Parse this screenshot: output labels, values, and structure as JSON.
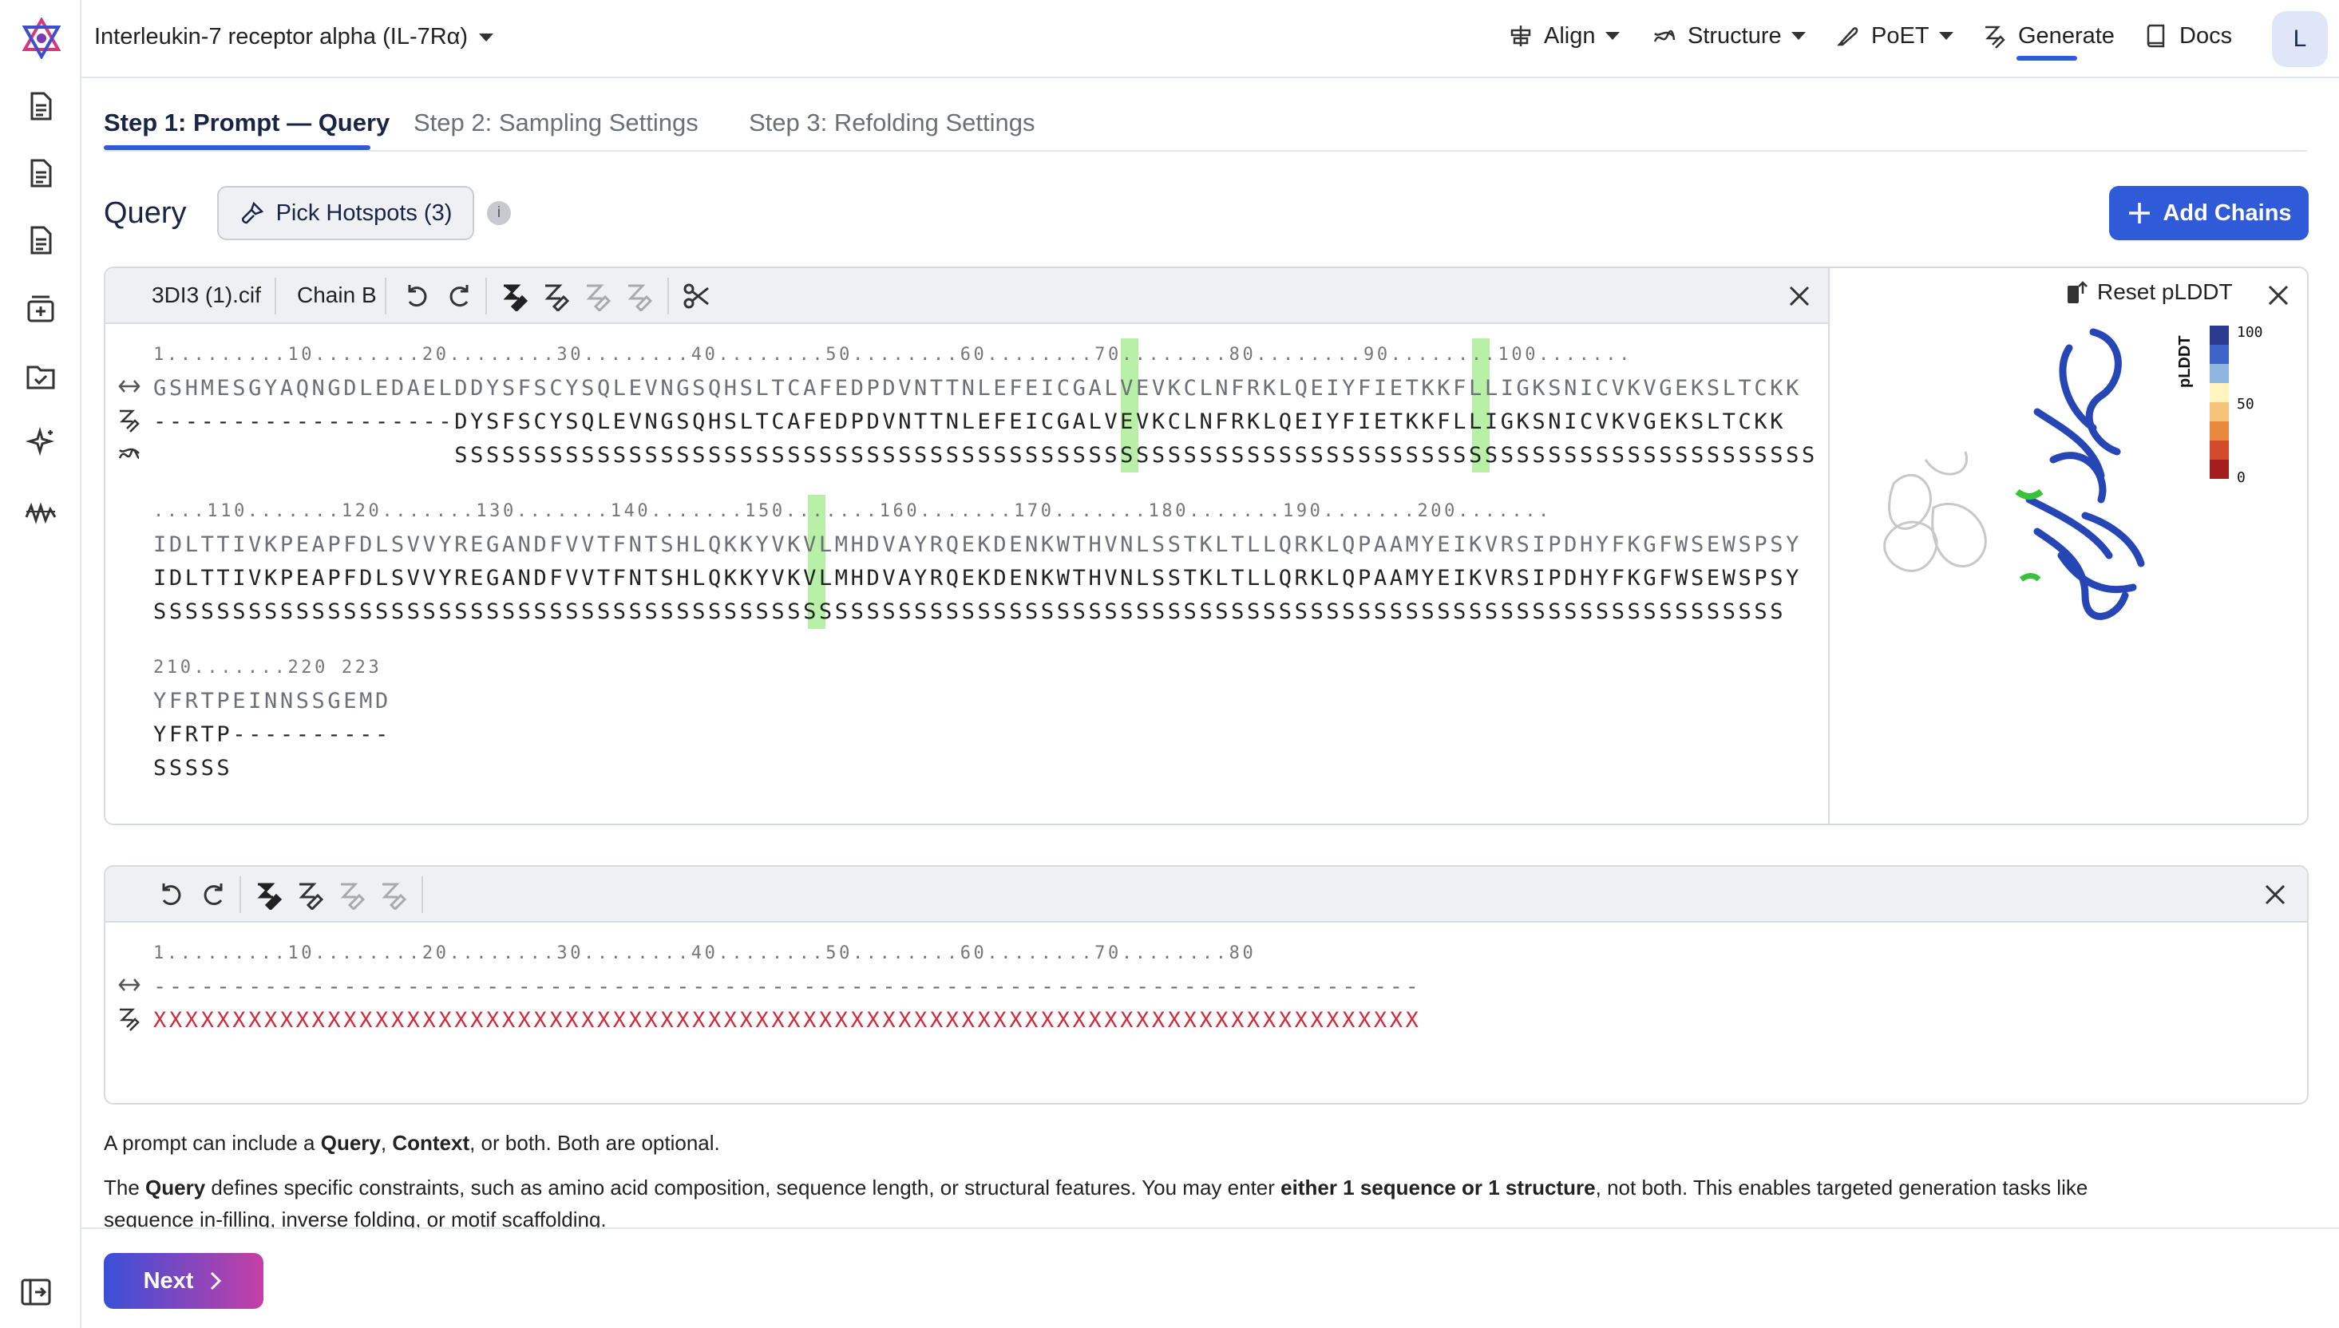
{
  "header": {
    "title": "Interleukin-7 receptor alpha (IL-7Rα)",
    "nav": [
      "Align",
      "Structure",
      "PoET",
      "Generate",
      "Docs"
    ],
    "avatar": "L"
  },
  "steps": [
    "Step 1: Prompt — Query",
    "Step 2: Sampling Settings",
    "Step 3: Refolding Settings"
  ],
  "query": {
    "label": "Query",
    "pick_hotspots": "Pick Hotspots (3)",
    "info": "i",
    "add_chains": "Add Chains"
  },
  "panel1": {
    "file": "3DI3 (1).cif",
    "chain": "Chain B",
    "block1": {
      "ruler": "1.........10........20........30........40........50........60........70........80........90........100.......",
      "seq": "GSHMESGYAQNGDLEDAELDDYSFSCYSQLEVNGSQHSLTCAFEDPDVNTTNLEFEICGALVEVKCLNFRKLQEIYFIETKKFLLIGKSNICVKVGEKSLTCKK",
      "design": "-------------------DYSFSCYSQLEVNGSQHSLTCAFEDPDVNTTNLEFEICGALVEVKCLNFRKLQEIYFIETKKFLLIGKSNICVKVGEKSLTCKK",
      "ss": "                   SSSSSSSSSSSSSSSSSSSSSSSSSSSSSSSSSSSSSSSSSSSSSSSSSSSSSSSSSSSSSSSSSSSSSSSSSSSSSSSSSSSSSS"
    },
    "block2": {
      "ruler": "....110.......120.......130.......140.......150.......160.......170.......180.......190.......200.......",
      "seq": "IDLTTIVKPEAPFDLSVVYREGANDFVVTFNTSHLQKKYVKVLMHDVAYRQEKDENKWTHVNLSSTKLTLLQRKLQPAAMYEIKVRSIPDHYFKGFWSEWSPSY",
      "design": "IDLTTIVKPEAPFDLSVVYREGANDFVVTFNTSHLQKKYVKVLMHDVAYRQEKDENKWTHVNLSSTKLTLLQRKLQPAAMYEIKVRSIPDHYFKGFWSEWSPSY",
      "ss": "SSSSSSSSSSSSSSSSSSSSSSSSSSSSSSSSSSSSSSSSSSSSSSSSSSSSSSSSSSSSSSSSSSSSSSSSSSSSSSSSSSSSSSSSSSSSSSSSSSSSSSS"
    },
    "block3": {
      "ruler": "210.......220 223",
      "seq": "YFRTPEINNSSGEMD",
      "design": "YFRTP----------",
      "ss": "SSSSS"
    }
  },
  "viewer": {
    "reset": "Reset pLDDT",
    "legend_title": "pLDDT",
    "ticks": [
      "100",
      "50",
      "0"
    ],
    "colors": [
      "#2b3a8f",
      "#3e63c8",
      "#8fb6e0",
      "#fff5c0",
      "#f5c27a",
      "#e8873e",
      "#d34a2a",
      "#a51d1d"
    ]
  },
  "panel2": {
    "ruler": "1.........10........20........30........40........50........60........70........80",
    "design": "--------------------------------------------------------------------------------",
    "seq": "XXXXXXXXXXXXXXXXXXXXXXXXXXXXXXXXXXXXXXXXXXXXXXXXXXXXXXXXXXXXXXXXXXXXXXXXXXXXXXXX"
  },
  "text": {
    "p1a": "A prompt can include a ",
    "p1b": "Query",
    ", ": ", ",
    "p1c": "Context",
    "p1d": ", or both. Both are optional.",
    "p2a": "The ",
    "p2b": "Query",
    "p2c": " defines specific constraints, such as amino acid composition, sequence length, or structural features. You may enter ",
    "p2d": "either 1 sequence or 1 structure",
    "p2e": ", not both. This enables targeted generation tasks like",
    "p3": "sequence in-filling, inverse folding, or motif scaffolding."
  },
  "footer": {
    "next": "Next"
  }
}
